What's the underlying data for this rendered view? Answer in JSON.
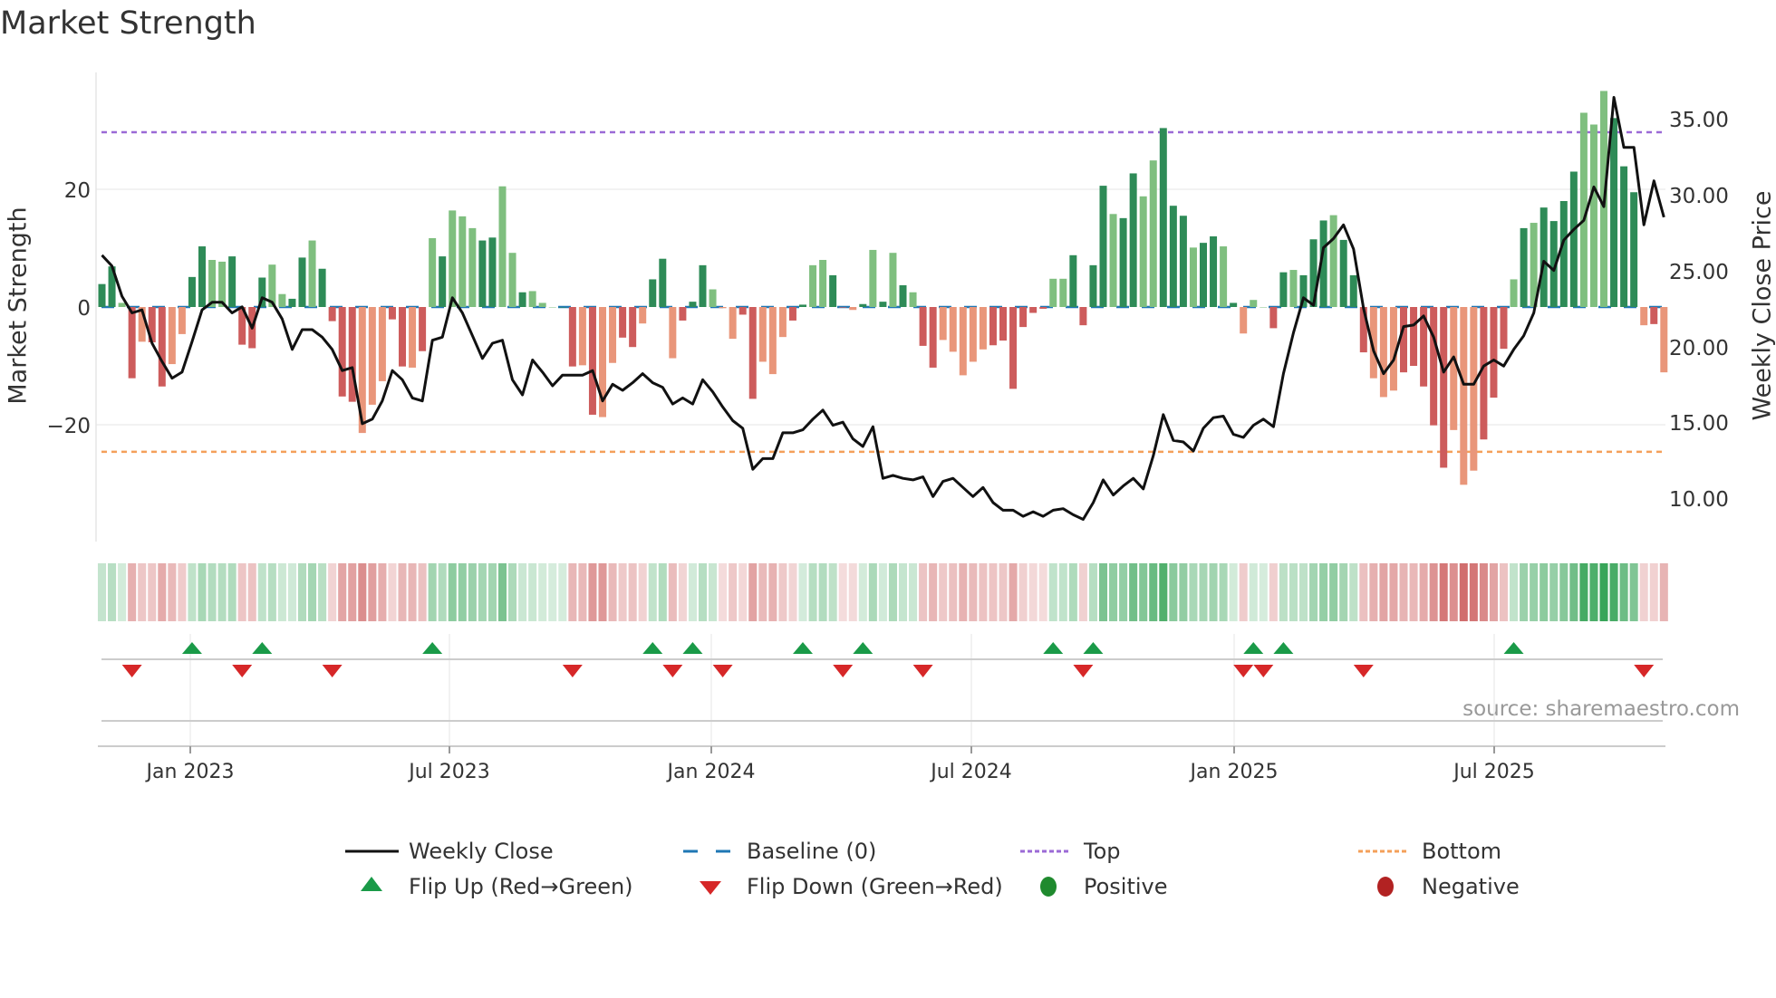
{
  "chart_data": {
    "type": "bar",
    "title": "Market Strength",
    "ylabel": "Market Strength",
    "y2label": "Weekly Close Price",
    "source": "source: sharemaestro.com",
    "ylim": [
      -40,
      38
    ],
    "y2lim": [
      7.5,
      37.5
    ],
    "yticks": [
      "20",
      "0",
      "−20"
    ],
    "y2ticks": [
      "35.00",
      "30.00",
      "25.00",
      "20.00",
      "15.00",
      "10.00"
    ],
    "xticks": [
      "Jan 2023",
      "Jul 2023",
      "Jan 2024",
      "Jul 2024",
      "Jan 2025",
      "Jul 2025"
    ],
    "top_level": 29.7,
    "bottom_level": -24.6,
    "strength": [
      3.9,
      6.9,
      0.7,
      -12.1,
      -5.9,
      -6.0,
      -13.5,
      -9.7,
      -4.6,
      5.1,
      10.3,
      8.0,
      7.7,
      8.6,
      -6.4,
      -7.0,
      5.0,
      7.2,
      2.2,
      1.4,
      8.4,
      11.3,
      6.5,
      -2.4,
      -15.2,
      -16.1,
      -21.4,
      -16.6,
      -12.6,
      -2.1,
      -10.1,
      -10.3,
      -7.5,
      11.7,
      8.6,
      16.4,
      15.4,
      13.4,
      11.3,
      11.8,
      20.5,
      9.2,
      2.5,
      2.7,
      0.7,
      0,
      0,
      -10.1,
      -9.9,
      -18.3,
      -18.7,
      -9.5,
      -5.2,
      -6.8,
      -2.8,
      4.7,
      8.2,
      -8.7,
      -2.3,
      0.9,
      7.1,
      3.0,
      -0.2,
      -5.4,
      -1.3,
      -15.6,
      -9.3,
      -11.4,
      -5.1,
      -2.3,
      0.4,
      7.1,
      8.0,
      5.4,
      -0.1,
      -0.5,
      0.5,
      9.7,
      0.9,
      9.2,
      3.7,
      2.5,
      -6.6,
      -10.3,
      -5.6,
      -7.6,
      -11.6,
      -9.3,
      -7.2,
      -6.5,
      -5.7,
      -13.9,
      -3.4,
      -1.0,
      -0.3,
      4.8,
      4.8,
      8.8,
      -3.1,
      7.1,
      20.6,
      15.8,
      15.1,
      22.7,
      18.8,
      24.9,
      30.4,
      17.2,
      15.5,
      10.1,
      10.9,
      12.0,
      10.3,
      0.7,
      -4.5,
      1.2,
      0,
      -3.6,
      5.9,
      6.3,
      5.4,
      11.5,
      14.7,
      15.6,
      11.4,
      5.4,
      -7.7,
      -12.1,
      -15.3,
      -14.2,
      -11.1,
      -10.0,
      -13.5,
      -20.1,
      -27.3,
      -20.9,
      -30.2,
      -27.8,
      -22.5,
      -15.4,
      -7.1,
      4.7,
      13.4,
      14.3,
      16.9,
      14.6,
      18.0,
      23.0,
      33.0,
      31.0,
      36.7,
      32.1,
      23.9,
      19.5,
      -3.1,
      -2.9,
      -11.1
    ],
    "shade": "ddldlddlldd lldddd ll ddld ddd lll ddl dl dlll ddl ld lll dd l dll d dl d dld ddl l ldd ll ldd l ldd ld ldl d ldd ll ll ld ddd d dlldddd l ddl l dd d ldd ld lll dd l d dd lddd ll lddd d dlll ddd ld ld ddd l l ld dd ld ll d ld",
    "close": [
      26.0,
      25.3,
      23.3,
      22.2,
      22.4,
      20.2,
      19.0,
      17.9,
      18.3,
      20.3,
      22.4,
      22.9,
      22.9,
      22.2,
      22.6,
      21.2,
      23.2,
      22.9,
      21.8,
      19.8,
      21.1,
      21.1,
      20.6,
      19.8,
      18.4,
      18.6,
      14.9,
      15.2,
      16.4,
      18.4,
      17.8,
      16.6,
      16.4,
      20.4,
      20.6,
      23.2,
      22.2,
      20.7,
      19.2,
      20.2,
      20.4,
      17.8,
      16.8,
      19.1,
      18.3,
      17.4,
      18.1,
      18.1,
      18.1,
      18.4,
      16.4,
      17.5,
      17.1,
      17.6,
      18.2,
      17.6,
      17.3,
      16.2,
      16.6,
      16.2,
      17.8,
      17.0,
      16.0,
      15.1,
      14.6,
      11.9,
      12.6,
      12.6,
      14.3,
      14.3,
      14.5,
      15.2,
      15.8,
      14.8,
      15.0,
      13.9,
      13.4,
      14.7,
      11.3,
      11.5,
      11.3,
      11.2,
      11.4,
      10.1,
      11.1,
      11.3,
      10.7,
      10.1,
      10.7,
      9.7,
      9.2,
      9.2,
      8.8,
      9.1,
      8.8,
      9.2,
      9.3,
      8.9,
      8.6,
      9.7,
      11.2,
      10.2,
      10.8,
      11.3,
      10.6,
      12.8,
      15.5,
      13.8,
      13.7,
      13.1,
      14.6,
      15.3,
      15.4,
      14.2,
      14.0,
      14.8,
      15.2,
      14.7,
      18.2,
      20.9,
      23.2,
      22.7,
      26.5,
      27.1,
      28.0,
      26.4,
      22.5,
      19.7,
      18.2,
      19.1,
      21.3,
      21.4,
      22.0,
      20.6,
      18.3,
      19.3,
      17.5,
      17.5,
      18.7,
      19.1,
      18.7,
      19.8,
      20.7,
      22.2,
      25.6,
      25.0,
      27.0,
      27.7,
      28.3,
      30.5,
      29.2,
      36.4,
      33.1,
      33.1,
      28.0,
      30.9,
      28.5
    ],
    "flip_up": [
      9,
      16,
      33,
      55,
      59,
      70,
      76,
      95,
      99,
      115,
      118,
      141
    ],
    "flip_down": [
      3,
      14,
      23,
      47,
      57,
      62,
      74,
      82,
      98,
      114,
      116,
      126,
      154
    ],
    "legend": [
      {
        "label": "Weekly Close",
        "icon": "line",
        "color": "#111111"
      },
      {
        "label": "Baseline (0)",
        "icon": "dash",
        "color": "#1f77b4"
      },
      {
        "label": "Top",
        "icon": "dot",
        "color": "#9b6ad6"
      },
      {
        "label": "Bottom",
        "icon": "dot",
        "color": "#f4a05a"
      },
      {
        "label": "Flip Up (Red→Green)",
        "icon": "triangle-up",
        "color": "#1a9a48"
      },
      {
        "label": "Flip Down (Green→Red)",
        "icon": "triangle-down",
        "color": "#d62728"
      },
      {
        "label": "Positive",
        "icon": "circle",
        "color": "#1f8a2e"
      },
      {
        "label": "Negative",
        "icon": "circle",
        "color": "#b22222"
      }
    ],
    "legend_position": "bottom",
    "colors": {
      "pos_dark": "#2e8b57",
      "pos_light": "#7fbf7f",
      "neg_dark": "#cd5c5c",
      "neg_light": "#e9967a",
      "line": "#111111"
    }
  }
}
